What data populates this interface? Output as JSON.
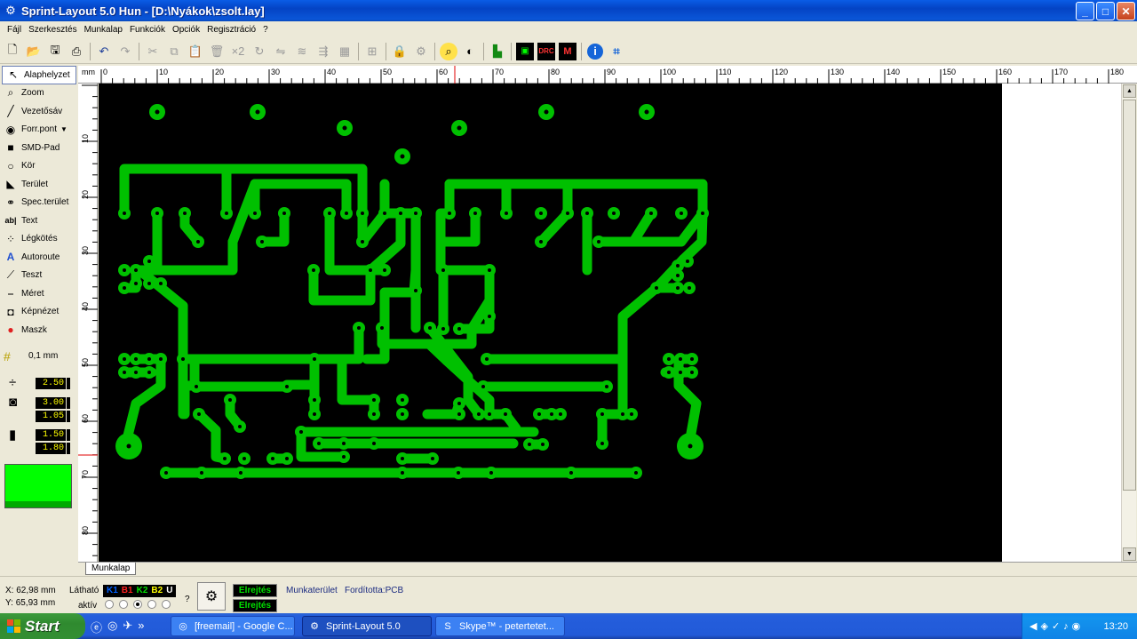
{
  "window": {
    "title": "Sprint-Layout 5.0 Hun    - [D:\\Nyákok\\zsolt.lay]",
    "min_label": "_",
    "max_label": "□",
    "close_label": "✕"
  },
  "menu": {
    "items": [
      "Fájl",
      "Szerkesztés",
      "Munkalap",
      "Funkciók",
      "Opciók",
      "Regisztráció",
      "?"
    ]
  },
  "tools": [
    {
      "name": "tool-alaphelyzet",
      "label": "Alaphelyzet",
      "icon": "arrow-icon",
      "glyph": "↖"
    },
    {
      "name": "tool-zoom",
      "label": "Zoom",
      "icon": "magnifier-icon",
      "glyph": "⌕"
    },
    {
      "name": "tool-vezetosav",
      "label": "Vezetősáv",
      "icon": "track-icon",
      "glyph": "╱"
    },
    {
      "name": "tool-forrpont",
      "label": "Forr.pont",
      "icon": "pad-icon",
      "glyph": "◉"
    },
    {
      "name": "tool-smd-pad",
      "label": "SMD-Pad",
      "icon": "smd-pad-icon",
      "glyph": "■"
    },
    {
      "name": "tool-kor",
      "label": "Kör",
      "icon": "circle-icon",
      "glyph": "○"
    },
    {
      "name": "tool-terulet",
      "label": "Terület",
      "icon": "area-icon",
      "glyph": "◣"
    },
    {
      "name": "tool-spec-terulet",
      "label": "Spec.terület",
      "icon": "special-area-icon",
      "glyph": "⚭"
    },
    {
      "name": "tool-text",
      "label": "Text",
      "icon": "text-icon",
      "glyph": "ab|"
    },
    {
      "name": "tool-legkotes",
      "label": "Légkötés",
      "icon": "airwire-icon",
      "glyph": "⁘"
    },
    {
      "name": "tool-autoroute",
      "label": "Autoroute",
      "icon": "autoroute-icon",
      "glyph": "A"
    },
    {
      "name": "tool-teszt",
      "label": "Teszt",
      "icon": "test-probe-icon",
      "glyph": "⟋"
    },
    {
      "name": "tool-meret",
      "label": "Méret",
      "icon": "measure-icon",
      "glyph": "⎯"
    },
    {
      "name": "tool-kepnezet",
      "label": "Képnézet",
      "icon": "camera-icon",
      "glyph": "◘"
    },
    {
      "name": "tool-maszk",
      "label": "Maszk",
      "icon": "mask-icon",
      "glyph": "●"
    }
  ],
  "grid": {
    "value": "0,1 mm"
  },
  "values": {
    "track_width": "2.50",
    "pad_outer": "3.00",
    "pad_inner": "1.05",
    "smd_width": "1.50",
    "smd_height": "1.80"
  },
  "colors": {
    "copper": "#00c000",
    "board": "#000000",
    "swatch": "#00ff00"
  },
  "ruler": {
    "unit": "mm",
    "top_ticks": [
      "0",
      "10",
      "20",
      "30",
      "40",
      "50",
      "60",
      "70",
      "80",
      "90",
      "100",
      "110",
      "120",
      "130",
      "140",
      "150",
      "160",
      "170",
      "180"
    ],
    "left_ticks": [
      "10",
      "20",
      "30",
      "40",
      "50",
      "60",
      "70",
      "80"
    ]
  },
  "sheet_tab": {
    "label": "Munkalap"
  },
  "status": {
    "x_label": "X:",
    "x_value": "62,98 mm",
    "y_label": "Y:",
    "y_value": "65,93 mm",
    "visible_label": "Látható",
    "active_label": "aktív",
    "layers": [
      {
        "label": "K1",
        "color": "#0060ff"
      },
      {
        "label": "B1",
        "color": "#ff2020"
      },
      {
        "label": "K2",
        "color": "#00e000"
      },
      {
        "label": "B2",
        "color": "#ffff00"
      },
      {
        "label": "U",
        "color": "#ffffff"
      }
    ],
    "help": "?",
    "hide_button_1": "Elrejtés",
    "hide_button_2": "Elrejtés",
    "workarea": "Munkaterület",
    "made_by": "Fordította:PCB"
  },
  "taskbar": {
    "start_label": "Start",
    "tasks": [
      {
        "label": "[freemail] - Google C...",
        "icon": "chrome-icon"
      },
      {
        "label": "Sprint-Layout 5.0",
        "icon": "sprint-layout-icon"
      },
      {
        "label": "Skype™ - petertetet...",
        "icon": "skype-icon"
      }
    ],
    "chevron": "»",
    "clock": "13:20"
  }
}
